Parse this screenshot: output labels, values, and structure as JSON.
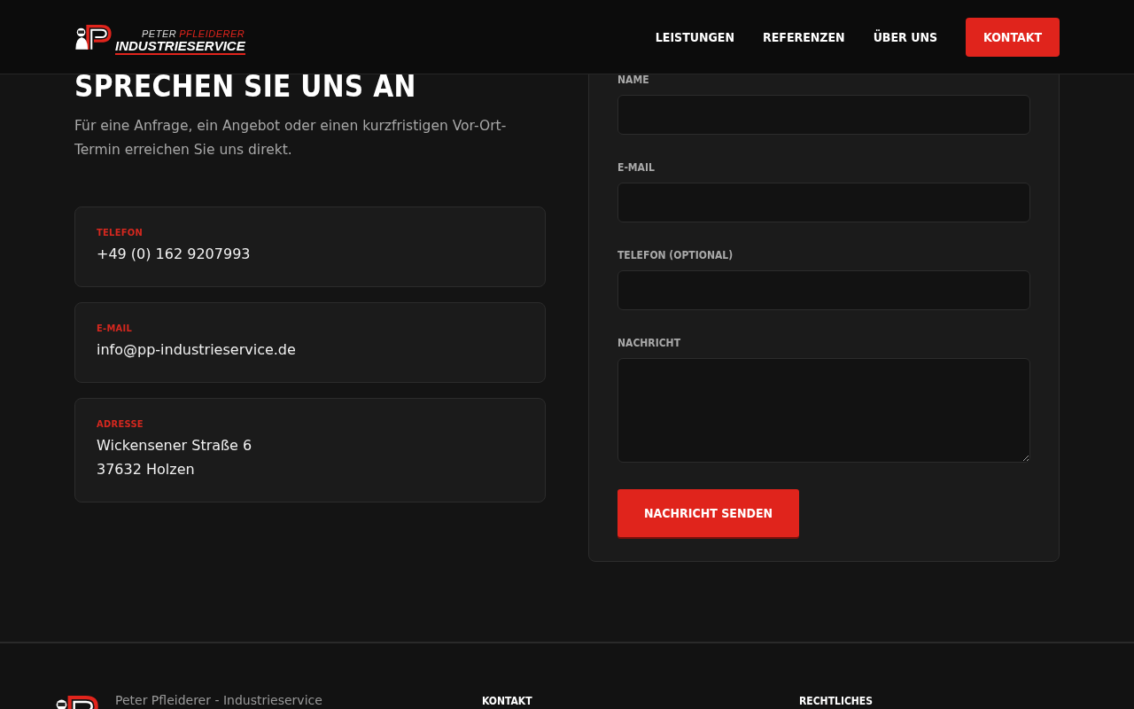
{
  "header": {
    "logo": {
      "line1_a": "PETER",
      "line1_b": "PFLEIDERER",
      "line2": "INDUSTRIESERVICE"
    },
    "nav": [
      {
        "label": "LEISTUNGEN",
        "kind": "link"
      },
      {
        "label": "REFERENZEN",
        "kind": "link"
      },
      {
        "label": "ÜBER UNS",
        "kind": "link"
      },
      {
        "label": "KONTAKT",
        "kind": "cta"
      }
    ]
  },
  "contact": {
    "heading": "SPRECHEN SIE UNS AN",
    "intro": "Für eine Anfrage, ein Angebot oder einen kurzfristigen Vor-Ort-Termin erreichen Sie uns direkt.",
    "cards": [
      {
        "label": "TELEFON",
        "lines": [
          "+49 (0) 162 9207993"
        ]
      },
      {
        "label": "E-MAIL",
        "lines": [
          "info@pp-industrieservice.de"
        ]
      },
      {
        "label": "ADRESSE",
        "lines": [
          "Wickensener Straße 6",
          "37632 Holzen"
        ]
      }
    ]
  },
  "form": {
    "fields": [
      {
        "label": "NAME",
        "kind": "input"
      },
      {
        "label": "E-MAIL",
        "kind": "input"
      },
      {
        "label": "TELEFON (OPTIONAL)",
        "kind": "input"
      },
      {
        "label": "NACHRICHT",
        "kind": "textarea"
      }
    ],
    "submit": "NACHRICHT SENDEN"
  },
  "footer": {
    "company": "Peter Pfleiderer - Industrieservice",
    "columns": [
      "KONTAKT",
      "RECHTLICHES"
    ]
  }
}
